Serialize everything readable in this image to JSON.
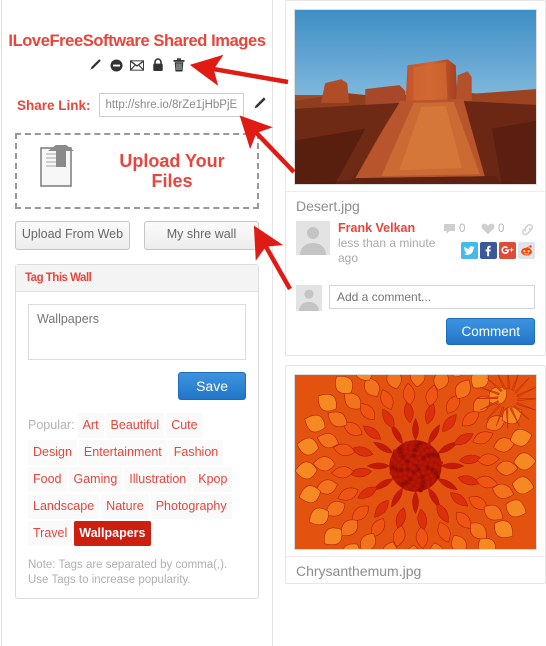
{
  "wall": {
    "title": "ILoveFreeSoftware Shared Images",
    "actions": [
      {
        "name": "edit-icon",
        "label": "Edit"
      },
      {
        "name": "block-icon",
        "label": "Block"
      },
      {
        "name": "mail-icon",
        "label": "Mail"
      },
      {
        "name": "lock-icon",
        "label": "Lock"
      },
      {
        "name": "trash-icon",
        "label": "Delete"
      }
    ],
    "share_label": "Share Link:",
    "share_value": "http://shre.io/8rZe1jHbPjE",
    "share_edit_icon": "pencil-icon",
    "upload_text": "Upload Your Files",
    "upload_icon": "upload-document-icon",
    "buttons": {
      "upload_from_web": "Upload From Web",
      "my_share_wall": "My shre wall"
    }
  },
  "tag_panel": {
    "header": "Tag This Wall",
    "textarea_value": "Wallpapers",
    "textarea_placeholder": "Wallpapers",
    "save_label": "Save",
    "popular_label": "Popular:",
    "tags": [
      {
        "label": "Art",
        "selected": false
      },
      {
        "label": "Beautiful",
        "selected": false
      },
      {
        "label": "Cute",
        "selected": false
      },
      {
        "label": "Design",
        "selected": false
      },
      {
        "label": "Entertainment",
        "selected": false
      },
      {
        "label": "Fashion",
        "selected": false
      },
      {
        "label": "Food",
        "selected": false
      },
      {
        "label": "Gaming",
        "selected": false
      },
      {
        "label": "Illustration",
        "selected": false
      },
      {
        "label": "Kpop",
        "selected": false
      },
      {
        "label": "Landscape",
        "selected": false
      },
      {
        "label": "Nature",
        "selected": false
      },
      {
        "label": "Photography",
        "selected": false
      },
      {
        "label": "Travel",
        "selected": false
      },
      {
        "label": "Wallpapers",
        "selected": true
      }
    ],
    "note": "Note: Tags are separated by comma(,). Use Tags to increase popularity."
  },
  "feed": [
    {
      "filename": "Desert.jpg",
      "image": "desert-monument-valley",
      "user": "Frank Velkan",
      "time": "less than a minute ago",
      "comment_count": "0",
      "like_count": "0",
      "link_icon": "chain-link-icon",
      "socials": [
        "twitter-icon",
        "facebook-icon",
        "googleplus-icon",
        "reddit-icon"
      ],
      "comment_placeholder": "Add a comment...",
      "comment_button": "Comment"
    },
    {
      "filename": "Chrysanthemum.jpg",
      "image": "chrysanthemum-flower",
      "user": "",
      "time": "",
      "comment_count": "",
      "like_count": "",
      "link_icon": "chain-link-icon",
      "socials": [],
      "comment_placeholder": "",
      "comment_button": ""
    }
  ],
  "colors": {
    "brand_red": "#e8453c",
    "selected_tag": "#cc1f10",
    "button_blue": "#2176c9",
    "arrow_red": "#e01b14"
  }
}
